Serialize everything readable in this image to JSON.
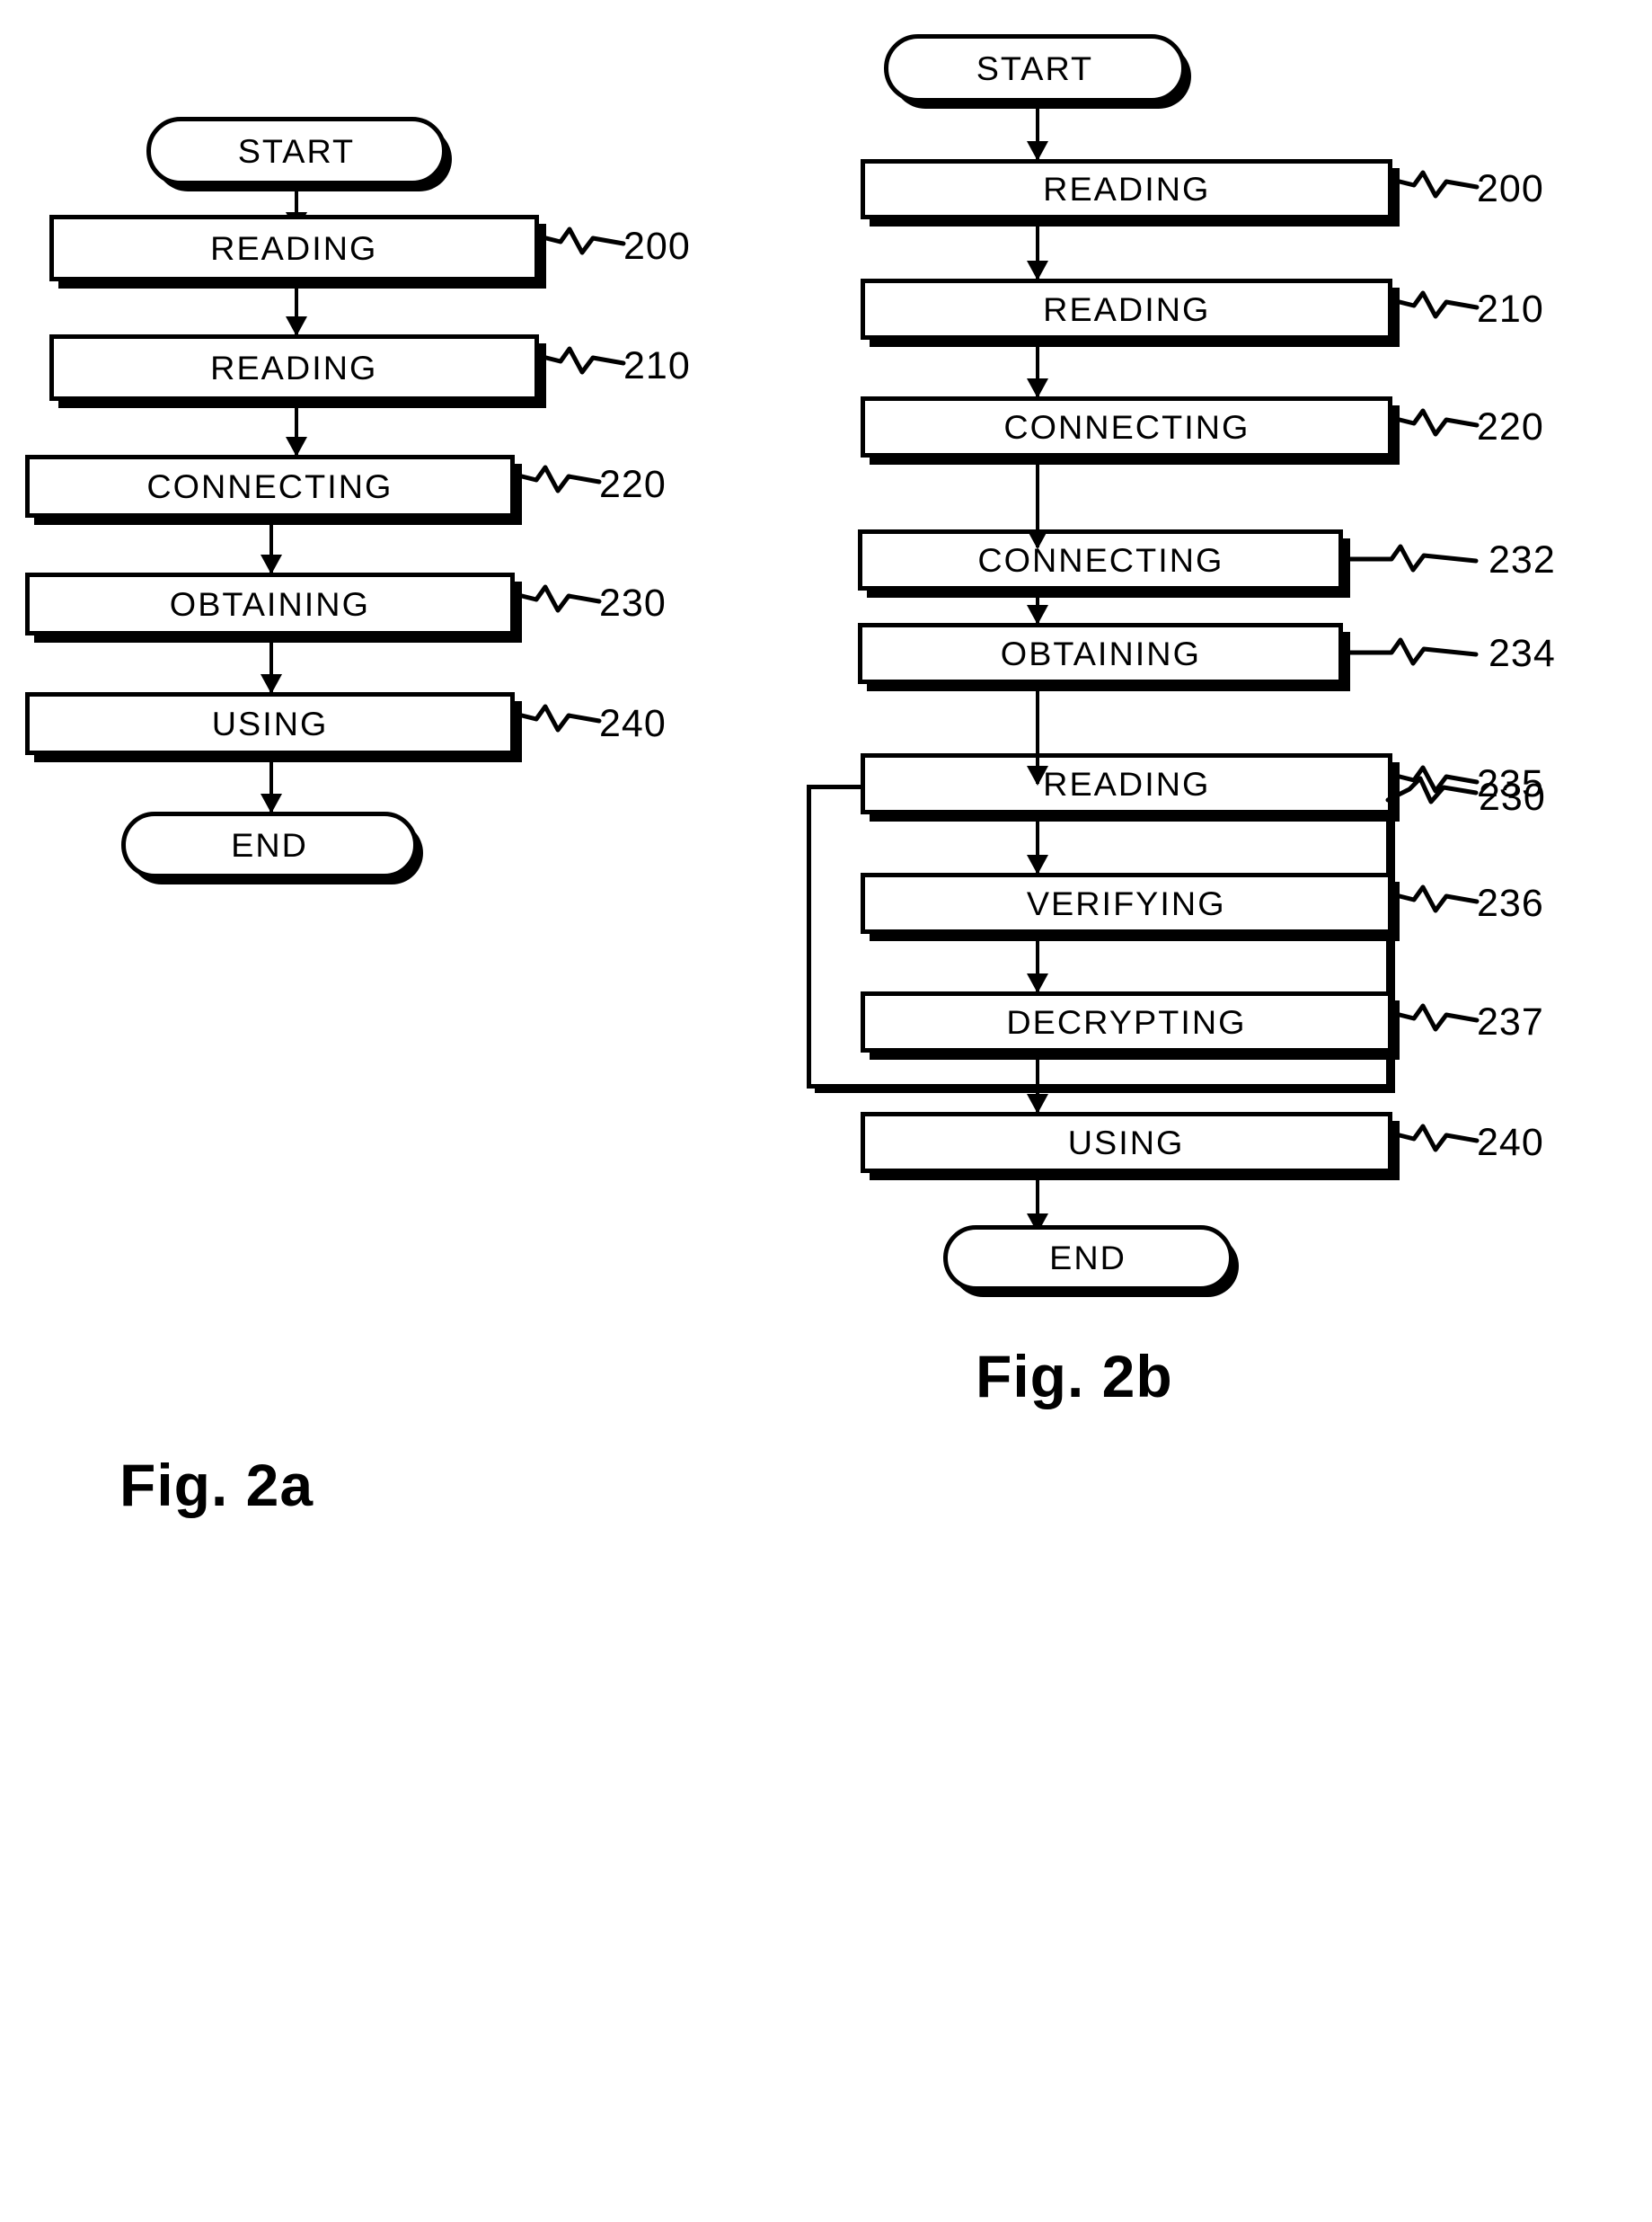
{
  "figure_a": {
    "caption": "Fig. 2a",
    "terminals": {
      "start": "START",
      "end": "END"
    },
    "steps": [
      {
        "label": "READING",
        "ref": "200"
      },
      {
        "label": "READING",
        "ref": "210"
      },
      {
        "label": "CONNECTING",
        "ref": "220"
      },
      {
        "label": "OBTAINING",
        "ref": "230"
      },
      {
        "label": "USING",
        "ref": "240"
      }
    ]
  },
  "figure_b": {
    "caption": "Fig. 2b",
    "terminals": {
      "start": "START",
      "end": "END"
    },
    "group": {
      "ref": "230"
    },
    "steps": [
      {
        "label": "READING",
        "ref": "200"
      },
      {
        "label": "READING",
        "ref": "210"
      },
      {
        "label": "CONNECTING",
        "ref": "220"
      },
      {
        "label": "CONNECTING",
        "ref": "232"
      },
      {
        "label": "OBTAINING",
        "ref": "234"
      },
      {
        "label": "READING",
        "ref": "235"
      },
      {
        "label": "VERIFYING",
        "ref": "236"
      },
      {
        "label": "DECRYPTING",
        "ref": "237"
      },
      {
        "label": "USING",
        "ref": "240"
      }
    ]
  },
  "colors": {
    "ink": "#000000",
    "paper": "#ffffff"
  }
}
